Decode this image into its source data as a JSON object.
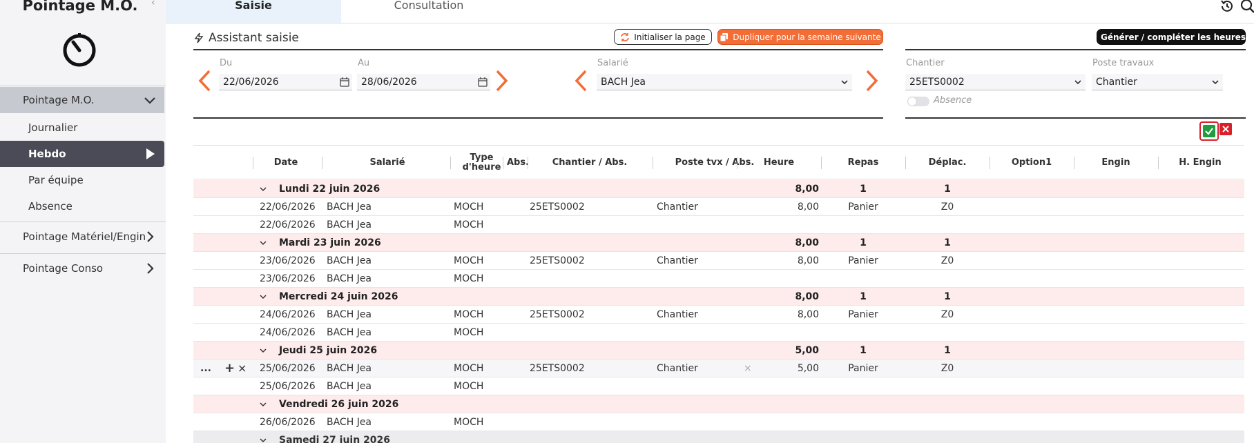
{
  "sidebar": {
    "app_title": "Pointage M.O.",
    "collapse_glyph": "‹",
    "logo_icon": "stopwatch-icon",
    "items": [
      {
        "label": "Pointage M.O."
      },
      {
        "label": "Journalier"
      },
      {
        "label": "Hebdo"
      },
      {
        "label": "Par équipe"
      },
      {
        "label": "Absence"
      },
      {
        "label": "Pointage Matériel/Engin"
      },
      {
        "label": "Pointage Conso"
      }
    ]
  },
  "tabs": [
    {
      "label": "Saisie"
    },
    {
      "label": "Consultation"
    }
  ],
  "assistant": {
    "title": "Assistant saisie",
    "init_button": "Initialiser la page",
    "duplicate_button": "Dupliquer pour la semaine suivante",
    "generate_button": "Générer / compléter les heures",
    "du_label": "Du",
    "du_value": "22/06/2026",
    "au_label": "Au",
    "au_value": "28/06/2026",
    "salarie_label": "Salarié",
    "salarie_value": "BACH Jea",
    "chantier_label": "Chantier",
    "chantier_value": "25ETS0002",
    "poste_label": "Poste travaux",
    "poste_value": "Chantier",
    "absence_label": "Absence"
  },
  "colors": {
    "accent_orange": "#f36d36",
    "group_row_bg": "#fdeceb",
    "validate_green": "#1f9c3e",
    "cancel_red": "#d8202a",
    "active_nav_bg": "#4a4b57"
  },
  "table": {
    "headers": {
      "date": "Date",
      "salarie": "Salarié",
      "type_heure_1": "Type",
      "type_heure_2": "d'heure",
      "abs": "Abs.",
      "chantier": "Chantier / Abs.",
      "poste": "Poste tvx / Abs.",
      "heure": "Heure",
      "repas": "Repas",
      "deplac": "Déplac.",
      "option1": "Option1",
      "engin": "Engin",
      "h_engin": "H. Engin"
    },
    "row_actions": {
      "more": "...",
      "add": "+",
      "delete": "×",
      "clear": "×"
    },
    "groups": [
      {
        "label": "Lundi 22 juin 2026",
        "heure": "8,00",
        "repas": "1",
        "deplac": "1",
        "rows": [
          {
            "date": "22/06/2026",
            "salarie": "BACH Jea",
            "type": "MOCH",
            "chantier": "25ETS0002",
            "poste": "Chantier",
            "heure": "8,00",
            "repas": "Panier",
            "deplac": "Z0"
          },
          {
            "date": "22/06/2026",
            "salarie": "BACH Jea",
            "type": "MOCH"
          }
        ]
      },
      {
        "label": "Mardi 23 juin 2026",
        "heure": "8,00",
        "repas": "1",
        "deplac": "1",
        "rows": [
          {
            "date": "23/06/2026",
            "salarie": "BACH Jea",
            "type": "MOCH",
            "chantier": "25ETS0002",
            "poste": "Chantier",
            "heure": "8,00",
            "repas": "Panier",
            "deplac": "Z0"
          },
          {
            "date": "23/06/2026",
            "salarie": "BACH Jea",
            "type": "MOCH"
          }
        ]
      },
      {
        "label": "Mercredi 24 juin 2026",
        "heure": "8,00",
        "repas": "1",
        "deplac": "1",
        "rows": [
          {
            "date": "24/06/2026",
            "salarie": "BACH Jea",
            "type": "MOCH",
            "chantier": "25ETS0002",
            "poste": "Chantier",
            "heure": "8,00",
            "repas": "Panier",
            "deplac": "Z0"
          },
          {
            "date": "24/06/2026",
            "salarie": "BACH Jea",
            "type": "MOCH"
          }
        ]
      },
      {
        "label": "Jeudi 25 juin 2026",
        "heure": "5,00",
        "repas": "1",
        "deplac": "1",
        "rows": [
          {
            "date": "25/06/2026",
            "salarie": "BACH Jea",
            "type": "MOCH",
            "chantier": "25ETS0002",
            "poste": "Chantier",
            "heure": "5,00",
            "repas": "Panier",
            "deplac": "Z0"
          },
          {
            "date": "25/06/2026",
            "salarie": "BACH Jea",
            "type": "MOCH"
          }
        ]
      },
      {
        "label": "Vendredi 26 juin 2026",
        "rows": [
          {
            "date": "26/06/2026",
            "salarie": "BACH Jea",
            "type": "MOCH"
          }
        ]
      },
      {
        "label": "Samedi 27 juin 2026",
        "rows": []
      }
    ]
  }
}
